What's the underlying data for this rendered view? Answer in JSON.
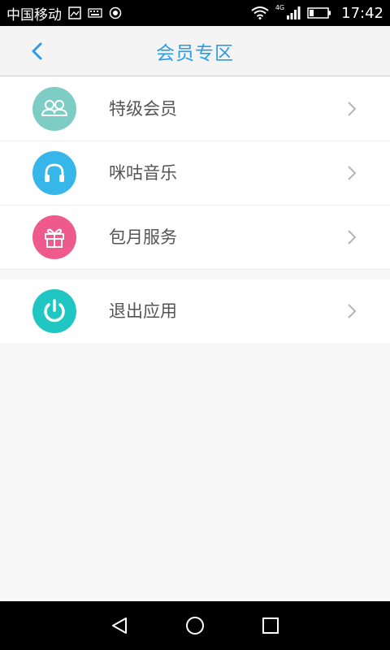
{
  "status_bar": {
    "carrier": "中国移动",
    "network": "4G",
    "time": "17:42",
    "icons": [
      "image-icon",
      "keyboard-icon",
      "app-icon",
      "wifi-icon",
      "signal-icon",
      "battery-icon"
    ]
  },
  "header": {
    "title": "会员专区",
    "back_icon": "chevron-left-icon",
    "accent_color": "#2b9de8"
  },
  "menu": {
    "items": [
      {
        "label": "特级会员",
        "icon": "people-icon",
        "color": "#7ecdc5"
      },
      {
        "label": "咪咕音乐",
        "icon": "headphones-icon",
        "color": "#37b6ea"
      },
      {
        "label": "包月服务",
        "icon": "gift-icon",
        "color": "#ef5a8c"
      },
      {
        "label": "退出应用",
        "icon": "power-icon",
        "color": "#20c6c1"
      }
    ],
    "chevron_icon": "chevron-right-icon"
  },
  "nav_bar": {
    "buttons": [
      "back-triangle-icon",
      "home-circle-icon",
      "recents-square-icon"
    ]
  }
}
